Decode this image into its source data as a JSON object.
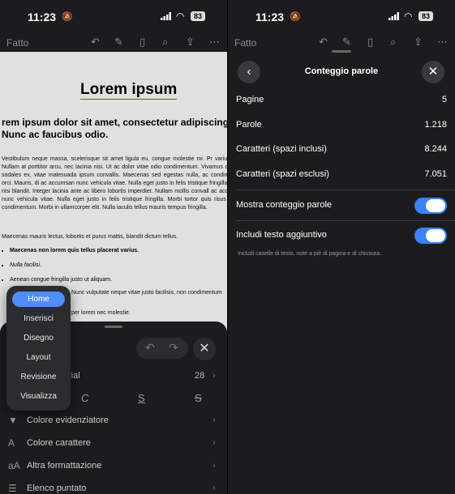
{
  "left": {
    "status": {
      "time": "11:23",
      "battery": "83"
    },
    "toolbar": {
      "done_label": "Fatto"
    },
    "doc": {
      "title": "Lorem ipsum",
      "subtitle": "rem ipsum dolor sit amet, consectetur adipiscing e Nunc ac faucibus odio.",
      "para1": "Vestibulum neque massa, scelerisque sit amet ligula eu, congue molestie mi. Pr varius sem. Nullam at porttitor arcu, nec lacinia nisi. Ut ac dolor vitae odio condimentum. Vivamus dapibus sodales ex, vitae malesuada ipsum convallis. Maecenas sed egestas nulla, ac condimentum orci. Mauris, di ac accumsan nunc vehicula vitae. Nulla eget justo in felis tristique fringilla. Morbi nisi blandit. Integer lacinia ante ac libero lobortis imperdiet. Nullam mollis convall ac accumsan nunc vehicula vitae. Nulla eget justo in felis tristique fringilla. Morbi tortor quis risus auctor condimentum. Morbi in ullamcorper elit. Nulla iaculis tellus mauris tempus fringilla.",
      "para2": "Maecenas mauris lectus, lobortis et purus mattis, blandit dictum tellus.",
      "list": [
        "Maecenas non lorem quis tellus placerat varius.",
        "Nulla facilisi.",
        "Aenean congue fringilla justo ut aliquam.",
        "Nunc vulputate neque vitae justo facilisis, non condimentum",
        "per lorem nec molestie."
      ]
    },
    "menu": {
      "items": [
        "Home",
        "Inserisci",
        "Disegno",
        "Layout",
        "Revisione",
        "Visualizza"
      ],
      "active_index": 0
    },
    "sheet": {
      "font_name": "rial",
      "font_size": "28",
      "style_buttons": [
        "C",
        "S",
        "S"
      ],
      "options": [
        {
          "icon": "highlighter-icon",
          "label": "Colore evidenziatore"
        },
        {
          "icon": "font-color-icon",
          "label": "Colore carattere"
        },
        {
          "icon": "text-format-icon",
          "label": "Altra formattazione"
        },
        {
          "icon": "bullet-list-icon",
          "label": "Elenco puntato"
        }
      ]
    }
  },
  "right": {
    "status": {
      "time": "11:23",
      "battery": "83"
    },
    "toolbar": {
      "done_label": "Fatto"
    },
    "panel": {
      "title": "Conteggio parole",
      "stats": [
        {
          "label": "Pagine",
          "value": "5"
        },
        {
          "label": "Parole",
          "value": "1.218"
        },
        {
          "label": "Caratteri (spazi inclusi)",
          "value": "8.244"
        },
        {
          "label": "Caratteri (spazi esclusi)",
          "value": "7.051"
        }
      ],
      "toggles": [
        {
          "label": "Mostra conteggio parole",
          "on": true
        },
        {
          "label": "Includi testo aggiuntivo",
          "on": true
        }
      ],
      "note": "Includi caselle di testo, note a piè di pagina e di chiusura."
    }
  },
  "colors": {
    "accent": "#4f8ef7",
    "toggle_on": "#3b82f6",
    "panel_bg": "#1c1c1e"
  }
}
